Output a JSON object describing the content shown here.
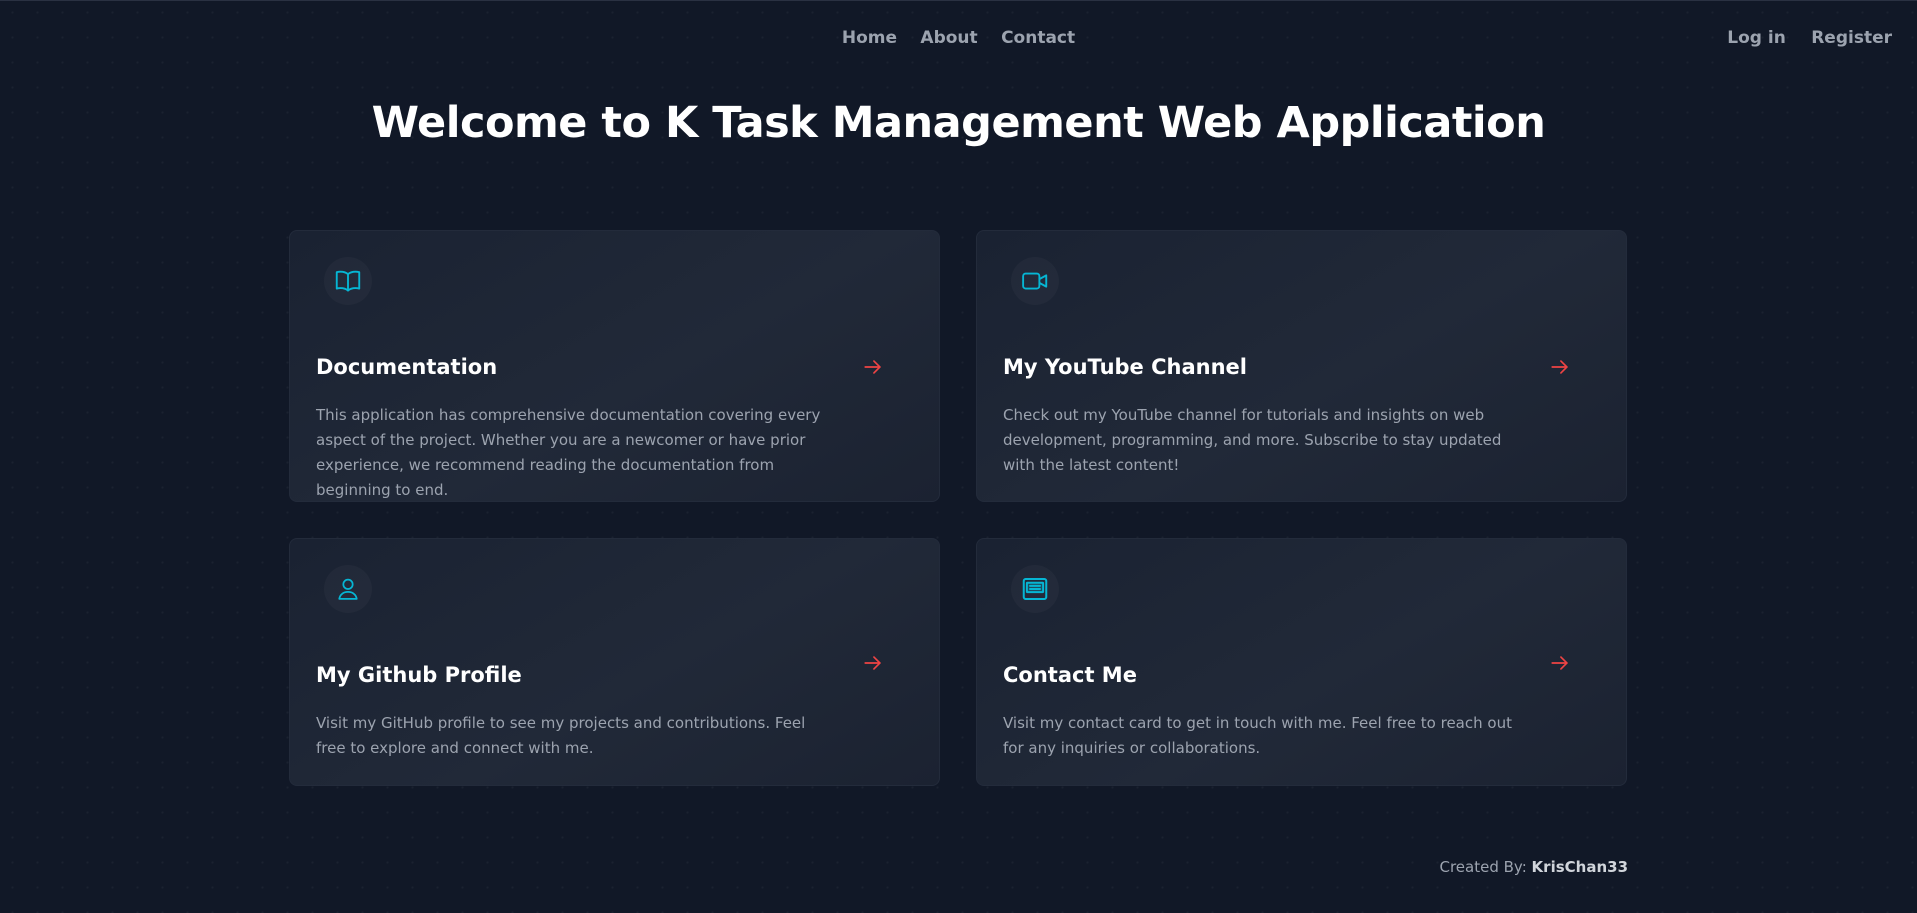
{
  "nav": {
    "home": "Home",
    "about": "About",
    "contact": "Contact",
    "login": "Log in",
    "register": "Register"
  },
  "page": {
    "title": "Welcome to K Task Management Web Application"
  },
  "cards": [
    {
      "icon": "book-open-icon",
      "title": "Documentation",
      "description": "This application has comprehensive documentation covering every aspect of the project. Whether you are a newcomer or have prior experience, we recommend reading the documentation from beginning to end."
    },
    {
      "icon": "video-camera-icon",
      "title": "My YouTube Channel",
      "description": "Check out my YouTube channel for tutorials and insights on web development, programming, and more. Subscribe to stay updated with the latest content!"
    },
    {
      "icon": "user-icon",
      "title": "My Github Profile",
      "description": "Visit my GitHub profile to see my projects and contributions. Feel free to explore and connect with me."
    },
    {
      "icon": "contact-card-icon",
      "title": "Contact Me",
      "description": "Visit my contact card to get in touch with me. Feel free to reach out for any inquiries or collaborations."
    }
  ],
  "footer": {
    "prefix": "Created By:",
    "author": "KrisChan33"
  },
  "colors": {
    "background": "#111827",
    "accent_icon": "#06b6d4",
    "arrow": "#ef4444",
    "muted_text": "#9ca3af"
  }
}
